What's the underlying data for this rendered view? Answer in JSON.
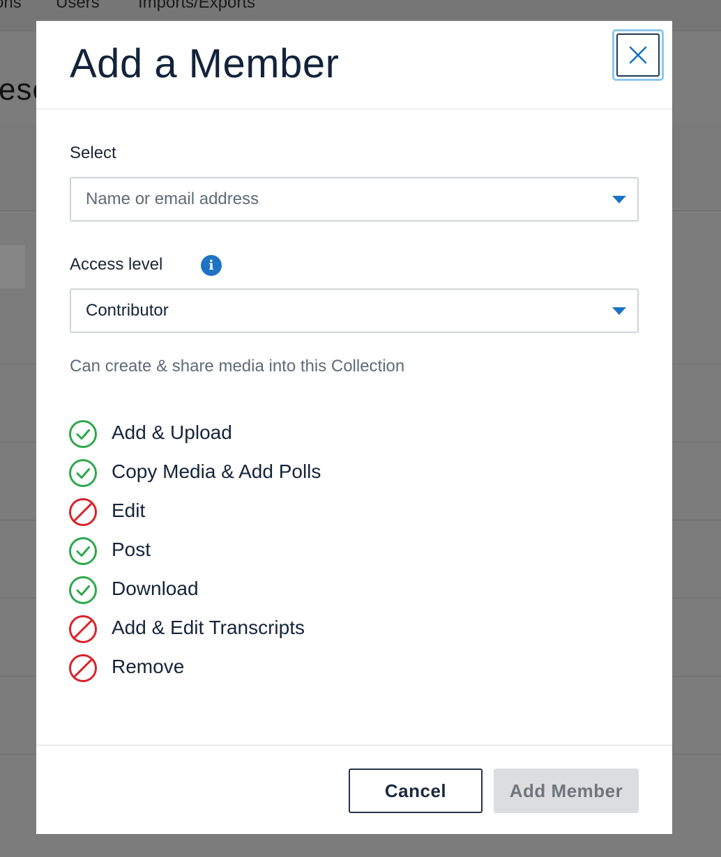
{
  "background": {
    "nav_items": [
      "ons",
      "Users",
      "Imports/Exports"
    ],
    "title_fragment": "ese"
  },
  "modal": {
    "title": "Add a Member",
    "close_icon": "close-icon",
    "select": {
      "label": "Select",
      "placeholder": "Name or email address"
    },
    "access": {
      "label": "Access level",
      "info_icon": "info-icon",
      "value": "Contributor",
      "description": "Can create & share media into this Collection"
    },
    "permissions": [
      {
        "label": "Add & Upload",
        "allowed": true
      },
      {
        "label": "Copy Media & Add Polls",
        "allowed": true
      },
      {
        "label": "Edit",
        "allowed": false
      },
      {
        "label": "Post",
        "allowed": true
      },
      {
        "label": "Download",
        "allowed": true
      },
      {
        "label": "Add & Edit Transcripts",
        "allowed": false
      },
      {
        "label": "Remove",
        "allowed": false
      }
    ],
    "footer": {
      "cancel_label": "Cancel",
      "submit_label": "Add Member",
      "submit_disabled": true
    }
  },
  "colors": {
    "allowed": "#2da84a",
    "denied": "#d9232a",
    "accent": "#1f73c4",
    "focus_ring": "#8ec7ec"
  }
}
